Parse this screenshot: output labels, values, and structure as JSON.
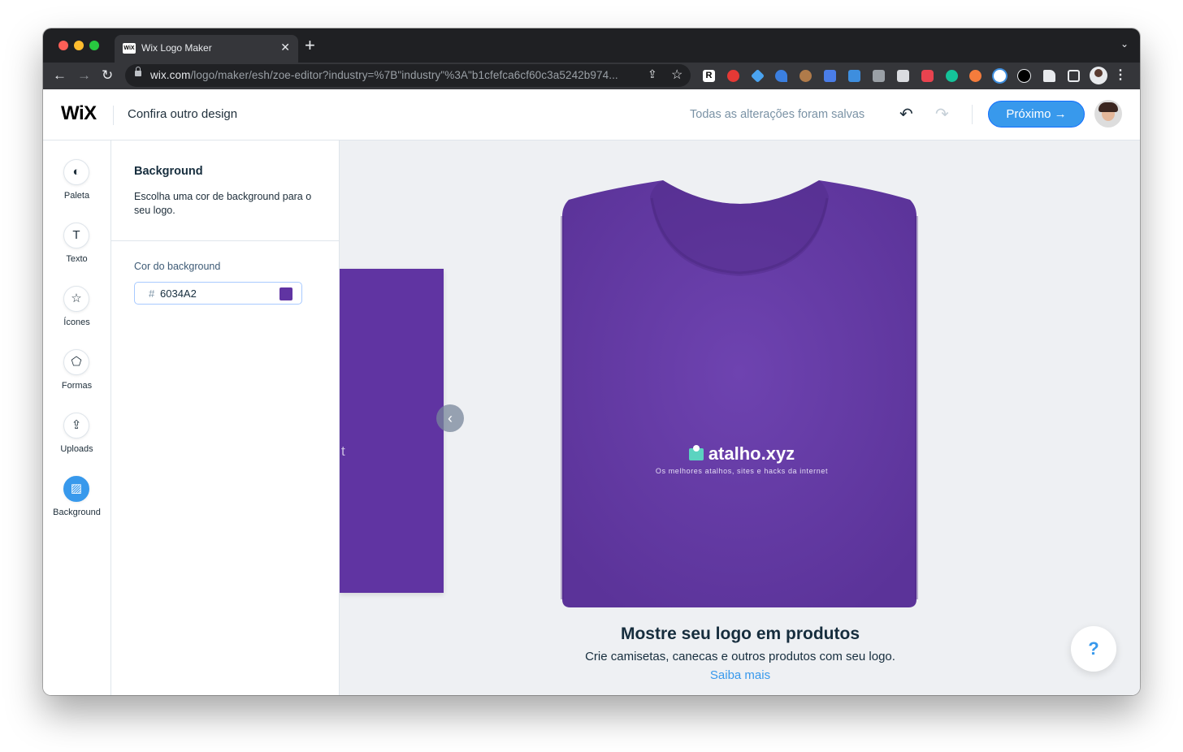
{
  "browser": {
    "tab_title": "Wix Logo Maker",
    "tab_favicon_text": "WiX",
    "tab_close": "✕",
    "new_tab": "+",
    "tab_menu": "⌄",
    "url_domain": "wix.com",
    "url_path": "/logo/maker/esh/zoe-editor?industry=%7B\"industry\"%3A\"b1cfefca6cf60c3a5242b974...",
    "back": "←",
    "forward": "→",
    "reload": "↻",
    "share": "⇪",
    "bookmark": "☆",
    "extension_r": "R",
    "menu": "⋮"
  },
  "header": {
    "logo": "WiX",
    "title": "Confira outro design",
    "saved_status": "Todas as alterações foram salvas",
    "undo": "↶",
    "redo": "↷",
    "next_label": "Próximo →"
  },
  "rail": {
    "items": [
      {
        "label": "Paleta",
        "icon": "◐"
      },
      {
        "label": "Texto",
        "icon": "T"
      },
      {
        "label": "Ícones",
        "icon": "☆"
      },
      {
        "label": "Formas",
        "icon": "⬠"
      },
      {
        "label": "Uploads",
        "icon": "⇪"
      },
      {
        "label": "Background",
        "icon": "▨"
      }
    ],
    "active": "Background"
  },
  "panel": {
    "title": "Background",
    "description": "Escolha uma cor de background para o seu logo.",
    "color_label": "Cor do background",
    "hash": "#",
    "color_value": "6034A2"
  },
  "canvas": {
    "prev_arrow": "‹",
    "prev_letter": "t",
    "logo_name": "atalho.xyz",
    "logo_tagline": "Os melhores atalhos, sites e hacks da internet",
    "promo_title": "Mostre seu logo em produtos",
    "promo_text": "Crie camisetas, canecas e outros produtos com seu logo.",
    "promo_link": "Saiba mais",
    "help": "?"
  },
  "colors": {
    "background_color": "#6034A2",
    "shirt_color": "#6a3fab",
    "accent": "#3899ec",
    "logo_icon": "#5bd3c0"
  }
}
